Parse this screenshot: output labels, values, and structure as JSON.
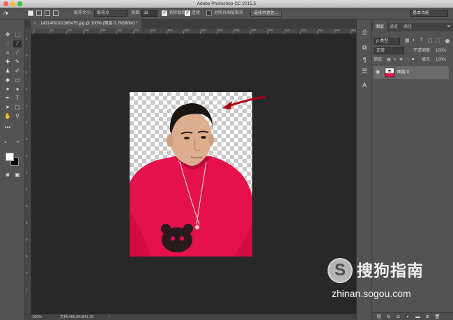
{
  "window": {
    "title": "Adobe Photoshop CC 2015.5"
  },
  "options_bar": {
    "sample_size_label": "取样大小:",
    "sample_size_value": "取样点",
    "tolerance_label": "容差:",
    "tolerance_value": "32",
    "anti_alias_label": "消除锯齿",
    "contiguous_label": "连续",
    "sample_all_layers_label": "对所有图层取样",
    "select_mask_button": "选择并遮住...",
    "workspace_value": "基本功能"
  },
  "document": {
    "tab_title": "1431409102385475.jpg @ 100% (图层 0, RGB/8#) *",
    "zoom": "100%",
    "doc_info": "文档:480.9K/641.2K"
  },
  "rulers": {
    "horizontal_ticks": [
      "0",
      "50",
      "100",
      "150",
      "200",
      "250",
      "300",
      "350",
      "400",
      "450",
      "500",
      "550",
      "600",
      "650",
      "700",
      "750",
      "800",
      "850",
      "900",
      "950"
    ],
    "vertical_ticks": [
      "0",
      "5",
      "1",
      "1",
      "2",
      "2",
      "3",
      "3",
      "4",
      "4",
      "5",
      "5",
      "6",
      "6",
      "7",
      "7"
    ]
  },
  "layers_panel": {
    "tabs": [
      "图层",
      "通道",
      "路径"
    ],
    "filter_kind": "ρ 类型",
    "blend_mode": "正常",
    "opacity_label": "不透明度:",
    "opacity_value": "100%",
    "lock_label": "锁定:",
    "fill_label": "填充:",
    "fill_value": "100%",
    "layers": [
      {
        "name": "图层 0"
      }
    ]
  },
  "watermark": {
    "name": "搜狗指南",
    "url": "zhinan.sogou.com"
  },
  "colors": {
    "foreground": "#ffffff",
    "background": "#000000",
    "arrow": "#b00014",
    "shirt": "#e4114a"
  }
}
